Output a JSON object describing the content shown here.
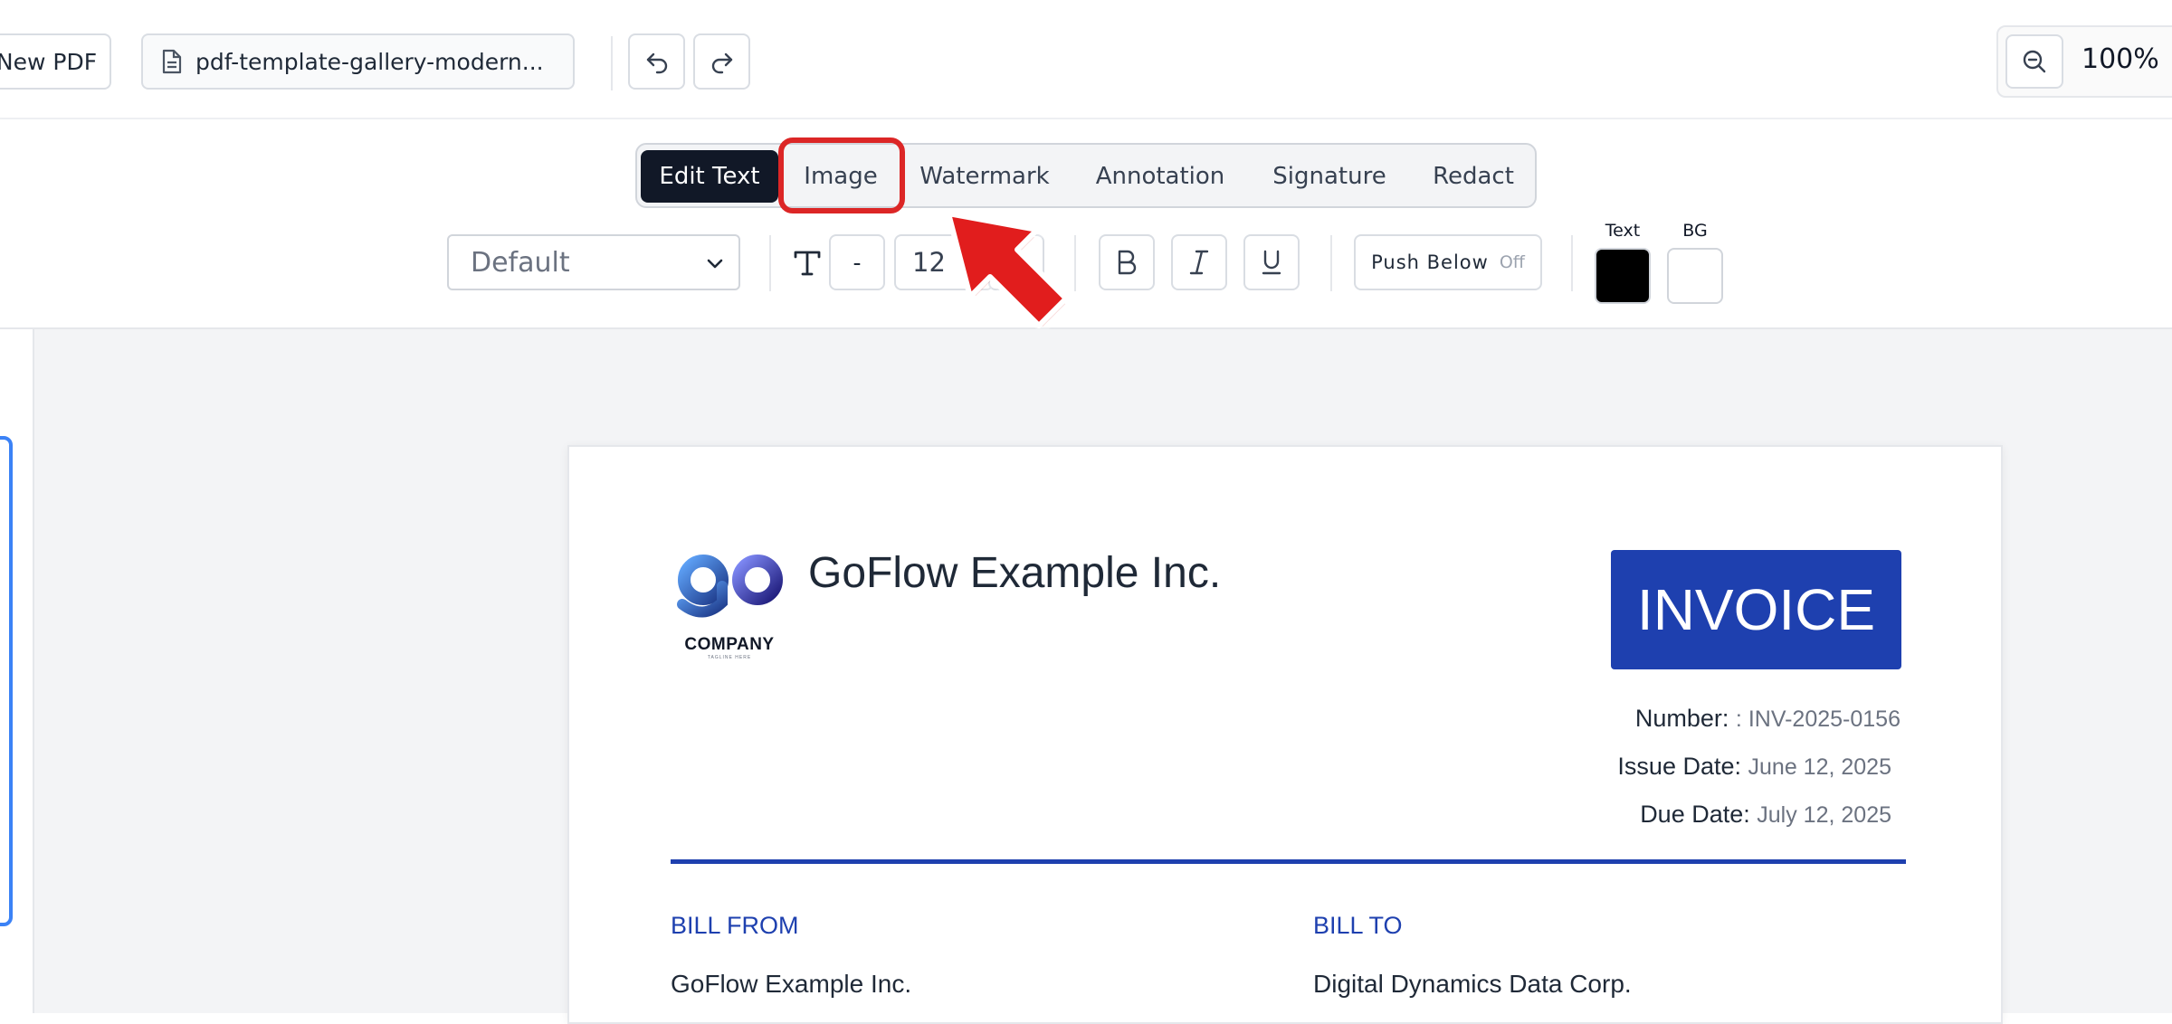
{
  "header": {
    "new_pdf_label": "New PDF",
    "file_name": "pdf-template-gallery-modern...",
    "zoom_level": "100%"
  },
  "tabs": [
    {
      "label": "Edit Text",
      "active": true
    },
    {
      "label": "Image",
      "active": false
    },
    {
      "label": "Watermark",
      "active": false
    },
    {
      "label": "Annotation",
      "active": false
    },
    {
      "label": "Signature",
      "active": false
    },
    {
      "label": "Redact",
      "active": false
    }
  ],
  "format_toolbar": {
    "font_select": "Default",
    "size_decrease": "-",
    "font_size": "12",
    "size_increase": "+",
    "push_below_label": "Push Below",
    "push_below_state": "Off",
    "text_color_label": "Text",
    "bg_color_label": "BG",
    "text_color": "#000000",
    "bg_color": "#ffffff"
  },
  "document": {
    "company_name": "GoFlow Example Inc.",
    "logo_text": "go",
    "logo_subtext": "COMPANY",
    "logo_tagline": "TAGLINE HERE",
    "invoice_title": "INVOICE",
    "meta": [
      {
        "label": "Number:",
        "value": ": INV-2025-0156"
      },
      {
        "label": "Issue Date:",
        "value": "June 12, 2025"
      },
      {
        "label": "Due Date:",
        "value": "July 12, 2025"
      }
    ],
    "bill_from_heading": "BILL FROM",
    "bill_from_name": "GoFlow Example Inc.",
    "bill_to_heading": "BILL TO",
    "bill_to_name": "Digital Dynamics Data Corp.",
    "accent_color": "#1e40af"
  }
}
